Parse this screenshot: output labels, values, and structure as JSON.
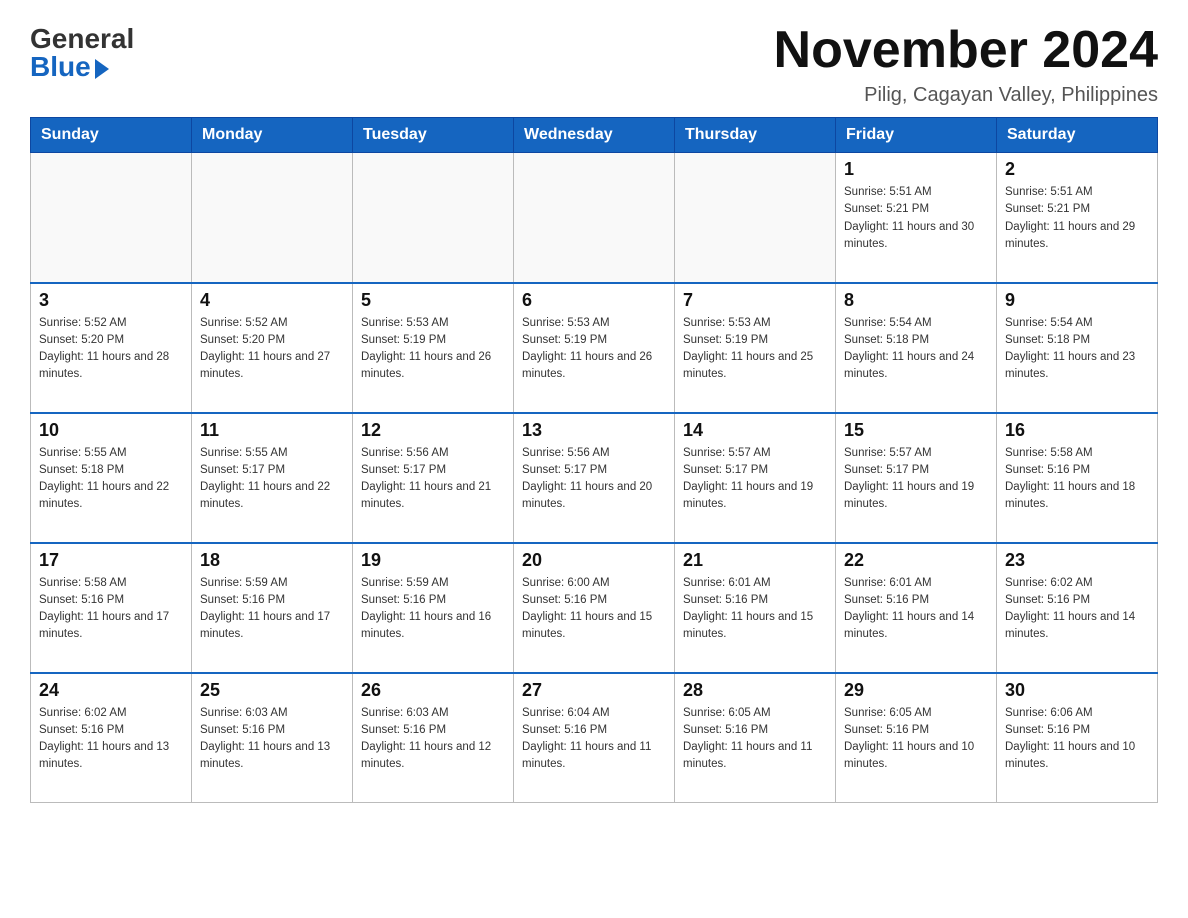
{
  "header": {
    "logo_general": "General",
    "logo_blue": "Blue",
    "month_title": "November 2024",
    "location": "Pilig, Cagayan Valley, Philippines"
  },
  "days_of_week": [
    "Sunday",
    "Monday",
    "Tuesday",
    "Wednesday",
    "Thursday",
    "Friday",
    "Saturday"
  ],
  "weeks": [
    [
      {
        "day": "",
        "sunrise": "",
        "sunset": "",
        "daylight": ""
      },
      {
        "day": "",
        "sunrise": "",
        "sunset": "",
        "daylight": ""
      },
      {
        "day": "",
        "sunrise": "",
        "sunset": "",
        "daylight": ""
      },
      {
        "day": "",
        "sunrise": "",
        "sunset": "",
        "daylight": ""
      },
      {
        "day": "",
        "sunrise": "",
        "sunset": "",
        "daylight": ""
      },
      {
        "day": "1",
        "sunrise": "Sunrise: 5:51 AM",
        "sunset": "Sunset: 5:21 PM",
        "daylight": "Daylight: 11 hours and 30 minutes."
      },
      {
        "day": "2",
        "sunrise": "Sunrise: 5:51 AM",
        "sunset": "Sunset: 5:21 PM",
        "daylight": "Daylight: 11 hours and 29 minutes."
      }
    ],
    [
      {
        "day": "3",
        "sunrise": "Sunrise: 5:52 AM",
        "sunset": "Sunset: 5:20 PM",
        "daylight": "Daylight: 11 hours and 28 minutes."
      },
      {
        "day": "4",
        "sunrise": "Sunrise: 5:52 AM",
        "sunset": "Sunset: 5:20 PM",
        "daylight": "Daylight: 11 hours and 27 minutes."
      },
      {
        "day": "5",
        "sunrise": "Sunrise: 5:53 AM",
        "sunset": "Sunset: 5:19 PM",
        "daylight": "Daylight: 11 hours and 26 minutes."
      },
      {
        "day": "6",
        "sunrise": "Sunrise: 5:53 AM",
        "sunset": "Sunset: 5:19 PM",
        "daylight": "Daylight: 11 hours and 26 minutes."
      },
      {
        "day": "7",
        "sunrise": "Sunrise: 5:53 AM",
        "sunset": "Sunset: 5:19 PM",
        "daylight": "Daylight: 11 hours and 25 minutes."
      },
      {
        "day": "8",
        "sunrise": "Sunrise: 5:54 AM",
        "sunset": "Sunset: 5:18 PM",
        "daylight": "Daylight: 11 hours and 24 minutes."
      },
      {
        "day": "9",
        "sunrise": "Sunrise: 5:54 AM",
        "sunset": "Sunset: 5:18 PM",
        "daylight": "Daylight: 11 hours and 23 minutes."
      }
    ],
    [
      {
        "day": "10",
        "sunrise": "Sunrise: 5:55 AM",
        "sunset": "Sunset: 5:18 PM",
        "daylight": "Daylight: 11 hours and 22 minutes."
      },
      {
        "day": "11",
        "sunrise": "Sunrise: 5:55 AM",
        "sunset": "Sunset: 5:17 PM",
        "daylight": "Daylight: 11 hours and 22 minutes."
      },
      {
        "day": "12",
        "sunrise": "Sunrise: 5:56 AM",
        "sunset": "Sunset: 5:17 PM",
        "daylight": "Daylight: 11 hours and 21 minutes."
      },
      {
        "day": "13",
        "sunrise": "Sunrise: 5:56 AM",
        "sunset": "Sunset: 5:17 PM",
        "daylight": "Daylight: 11 hours and 20 minutes."
      },
      {
        "day": "14",
        "sunrise": "Sunrise: 5:57 AM",
        "sunset": "Sunset: 5:17 PM",
        "daylight": "Daylight: 11 hours and 19 minutes."
      },
      {
        "day": "15",
        "sunrise": "Sunrise: 5:57 AM",
        "sunset": "Sunset: 5:17 PM",
        "daylight": "Daylight: 11 hours and 19 minutes."
      },
      {
        "day": "16",
        "sunrise": "Sunrise: 5:58 AM",
        "sunset": "Sunset: 5:16 PM",
        "daylight": "Daylight: 11 hours and 18 minutes."
      }
    ],
    [
      {
        "day": "17",
        "sunrise": "Sunrise: 5:58 AM",
        "sunset": "Sunset: 5:16 PM",
        "daylight": "Daylight: 11 hours and 17 minutes."
      },
      {
        "day": "18",
        "sunrise": "Sunrise: 5:59 AM",
        "sunset": "Sunset: 5:16 PM",
        "daylight": "Daylight: 11 hours and 17 minutes."
      },
      {
        "day": "19",
        "sunrise": "Sunrise: 5:59 AM",
        "sunset": "Sunset: 5:16 PM",
        "daylight": "Daylight: 11 hours and 16 minutes."
      },
      {
        "day": "20",
        "sunrise": "Sunrise: 6:00 AM",
        "sunset": "Sunset: 5:16 PM",
        "daylight": "Daylight: 11 hours and 15 minutes."
      },
      {
        "day": "21",
        "sunrise": "Sunrise: 6:01 AM",
        "sunset": "Sunset: 5:16 PM",
        "daylight": "Daylight: 11 hours and 15 minutes."
      },
      {
        "day": "22",
        "sunrise": "Sunrise: 6:01 AM",
        "sunset": "Sunset: 5:16 PM",
        "daylight": "Daylight: 11 hours and 14 minutes."
      },
      {
        "day": "23",
        "sunrise": "Sunrise: 6:02 AM",
        "sunset": "Sunset: 5:16 PM",
        "daylight": "Daylight: 11 hours and 14 minutes."
      }
    ],
    [
      {
        "day": "24",
        "sunrise": "Sunrise: 6:02 AM",
        "sunset": "Sunset: 5:16 PM",
        "daylight": "Daylight: 11 hours and 13 minutes."
      },
      {
        "day": "25",
        "sunrise": "Sunrise: 6:03 AM",
        "sunset": "Sunset: 5:16 PM",
        "daylight": "Daylight: 11 hours and 13 minutes."
      },
      {
        "day": "26",
        "sunrise": "Sunrise: 6:03 AM",
        "sunset": "Sunset: 5:16 PM",
        "daylight": "Daylight: 11 hours and 12 minutes."
      },
      {
        "day": "27",
        "sunrise": "Sunrise: 6:04 AM",
        "sunset": "Sunset: 5:16 PM",
        "daylight": "Daylight: 11 hours and 11 minutes."
      },
      {
        "day": "28",
        "sunrise": "Sunrise: 6:05 AM",
        "sunset": "Sunset: 5:16 PM",
        "daylight": "Daylight: 11 hours and 11 minutes."
      },
      {
        "day": "29",
        "sunrise": "Sunrise: 6:05 AM",
        "sunset": "Sunset: 5:16 PM",
        "daylight": "Daylight: 11 hours and 10 minutes."
      },
      {
        "day": "30",
        "sunrise": "Sunrise: 6:06 AM",
        "sunset": "Sunset: 5:16 PM",
        "daylight": "Daylight: 11 hours and 10 minutes."
      }
    ]
  ]
}
